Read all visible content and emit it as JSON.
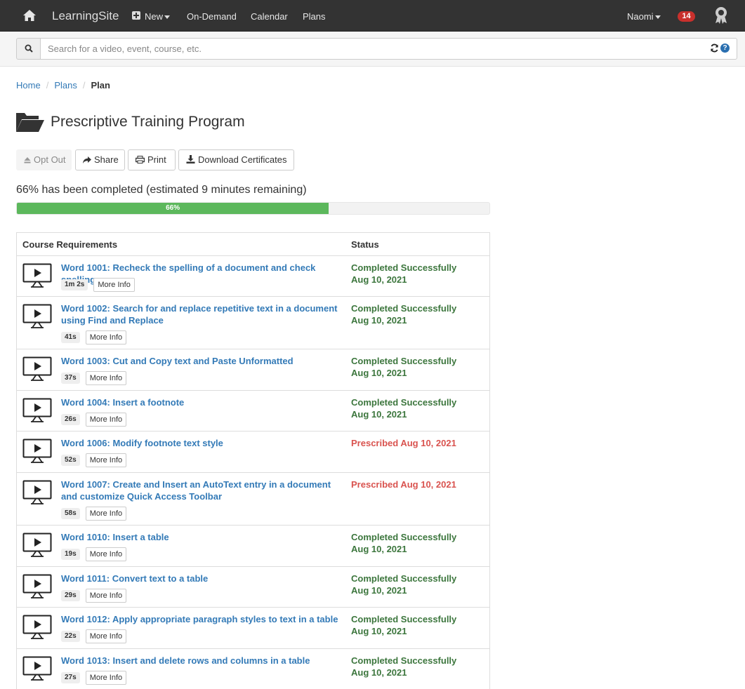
{
  "nav": {
    "brand": "LearningSite",
    "new_label": "New",
    "on_demand": "On-Demand",
    "calendar": "Calendar",
    "plans": "Plans",
    "user": "Naomi",
    "notifications": "14"
  },
  "search": {
    "placeholder": "Search for a video, event, course, etc."
  },
  "breadcrumb": {
    "home": "Home",
    "plans": "Plans",
    "current": "Plan"
  },
  "page": {
    "title": "Prescriptive Training Program"
  },
  "actions": {
    "opt_out": "Opt Out",
    "share": "Share",
    "print": "Print",
    "download": "Download Certificates"
  },
  "progress": {
    "text": "66% has been completed (estimated 9 minutes remaining)",
    "label": "66%",
    "value": 66
  },
  "table": {
    "headers": {
      "requirements": "Course Requirements",
      "status": "Status"
    },
    "more_label": "More Info",
    "rows": [
      {
        "title": "Word 1001: Recheck the spelling of a document and check spelling",
        "duration": "1m 2s",
        "status": "Completed Successfully",
        "date": "Aug 10, 2021",
        "kind": "ok"
      },
      {
        "title": "Word 1002: Search for and replace repetitive text in a document using Find and Replace",
        "duration": "41s",
        "status": "Completed Successfully",
        "date": "Aug 10, 2021",
        "kind": "ok"
      },
      {
        "title": "Word 1003: Cut and Copy text and Paste Unformatted",
        "duration": "37s",
        "status": "Completed Successfully",
        "date": "Aug 10, 2021",
        "kind": "ok"
      },
      {
        "title": "Word 1004: Insert a footnote",
        "duration": "26s",
        "status": "Completed Successfully",
        "date": "Aug 10, 2021",
        "kind": "ok"
      },
      {
        "title": "Word 1006: Modify footnote text style",
        "duration": "52s",
        "status": "Prescribed Aug 10, 2021",
        "date": "",
        "kind": "pres"
      },
      {
        "title": "Word 1007: Create and Insert an AutoText entry in a document and customize Quick Access Toolbar",
        "duration": "58s",
        "status": "Prescribed Aug 10, 2021",
        "date": "",
        "kind": "pres"
      },
      {
        "title": "Word 1010: Insert a table",
        "duration": "19s",
        "status": "Completed Successfully",
        "date": "Aug 10, 2021",
        "kind": "ok"
      },
      {
        "title": "Word 1011: Convert text to a table",
        "duration": "29s",
        "status": "Completed Successfully",
        "date": "Aug 10, 2021",
        "kind": "ok"
      },
      {
        "title": "Word 1012: Apply appropriate paragraph styles to text in a table",
        "duration": "22s",
        "status": "Completed Successfully",
        "date": "Aug 10, 2021",
        "kind": "ok"
      },
      {
        "title": "Word 1013: Insert and delete rows and columns in a table",
        "duration": "27s",
        "status": "Completed Successfully",
        "date": "Aug 10, 2021",
        "kind": "ok"
      }
    ]
  },
  "colors": {
    "navbar": "#333333",
    "link": "#337ab7",
    "success": "#3c763d",
    "danger": "#d9534f",
    "progress": "#5cb85c"
  }
}
